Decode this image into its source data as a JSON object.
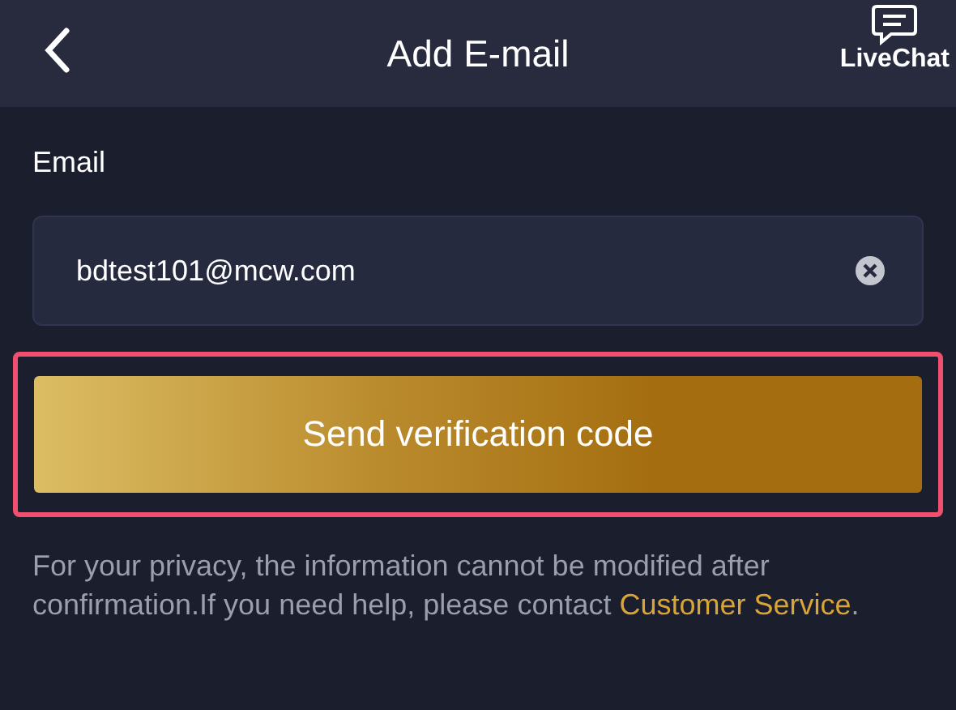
{
  "header": {
    "title": "Add E-mail",
    "live_chat": "LiveChat"
  },
  "form": {
    "label": "Email",
    "field": {
      "value": "bdtest101@mcw.com"
    },
    "button": {
      "label": "Send verification code",
      "highlighted": true
    }
  },
  "notice": {
    "text": "For your privacy, the information cannot be modified after confirmation.If you need help, please contact",
    "link": "Customer Service",
    "end": "."
  }
}
